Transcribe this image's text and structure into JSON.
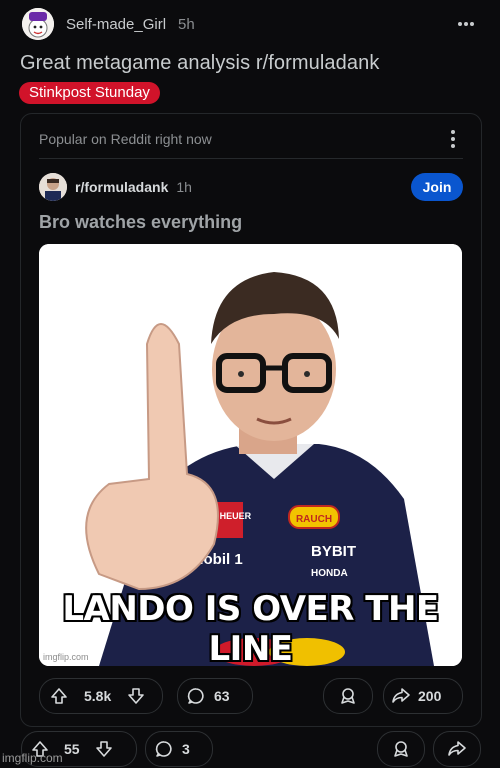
{
  "post": {
    "author": "Self-made_Girl",
    "time": "5h",
    "title": "Great metagame analysis r/formuladank",
    "flair": "Stinkpost Stunday"
  },
  "embed": {
    "header": "Popular on Reddit right now",
    "subreddit": "r/formuladank",
    "time": "1h",
    "join_label": "Join",
    "title": "Bro watches everything",
    "meme_caption": "LANDO IS OVER THE LINE",
    "meme_watermark": "imgflip.com",
    "meme_logos": [
      "TAG HEUER",
      "RAUCH",
      "Mobil 1",
      "BYBIT",
      "HONDA"
    ],
    "votes": "5.8k",
    "comments": "63",
    "shares": "200"
  },
  "footer": {
    "votes": "55",
    "comments": "3"
  },
  "watermark": "imgflip.com",
  "colors": {
    "background": "#0b0b0d",
    "flair": "#d1132a",
    "join": "#0a56cf"
  }
}
